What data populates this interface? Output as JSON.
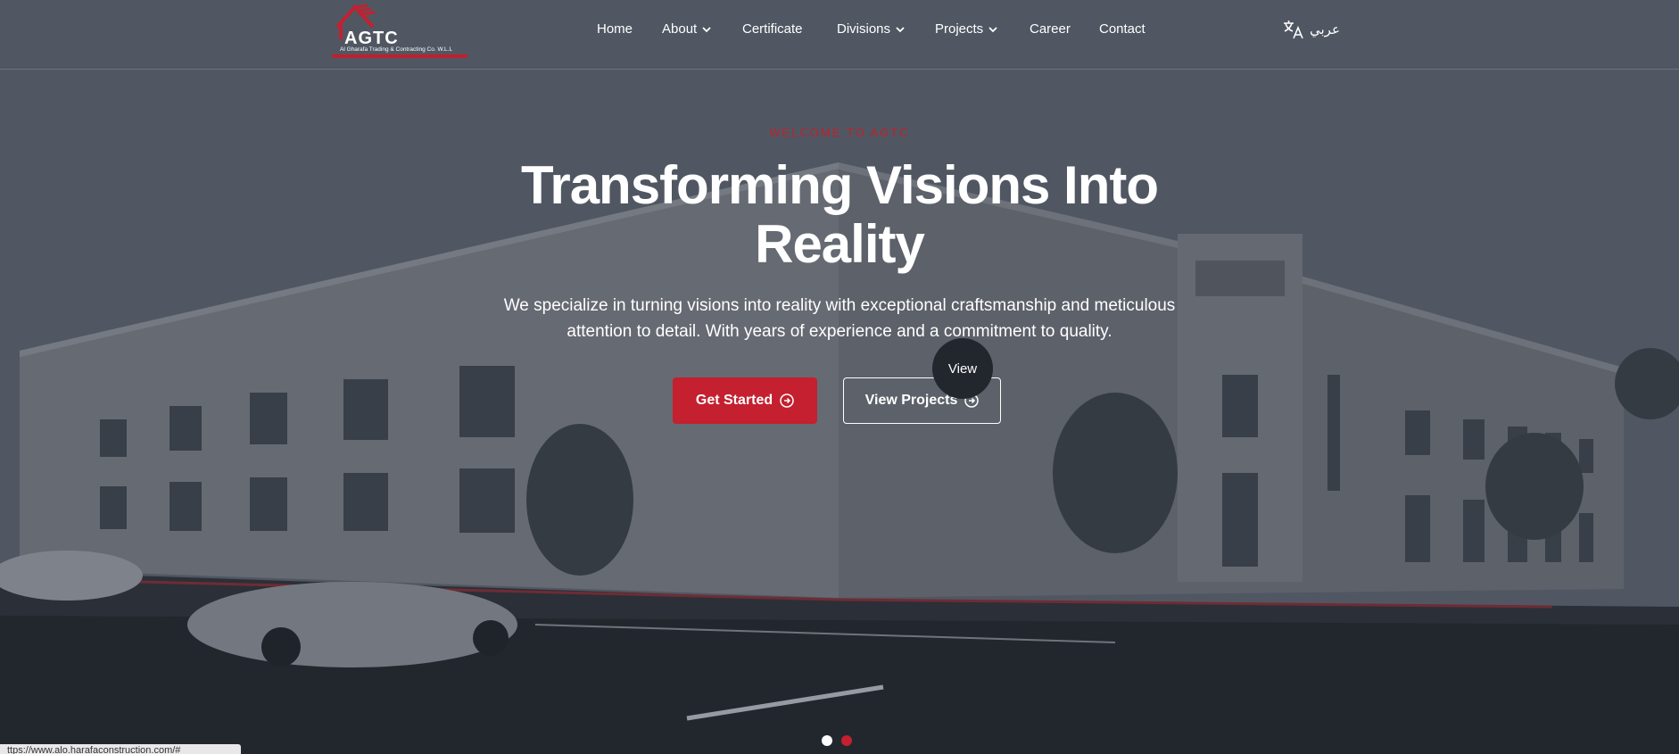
{
  "brand": {
    "name": "AGTC",
    "tagline": "Al Gharafa Trading & Contracting Co. W.L.L",
    "accent": "#c4202f"
  },
  "nav": {
    "items": [
      {
        "label": "Home",
        "has_dropdown": false
      },
      {
        "label": "About",
        "has_dropdown": true
      },
      {
        "label": "Certificate",
        "has_dropdown": false
      },
      {
        "label": "Divisions",
        "has_dropdown": true
      },
      {
        "label": "Projects",
        "has_dropdown": true
      },
      {
        "label": "Career",
        "has_dropdown": false
      },
      {
        "label": "Contact",
        "has_dropdown": false
      }
    ],
    "language_label": "عربي",
    "language_icon": "translate-icon"
  },
  "hero": {
    "eyebrow": "WELCOME TO AGTC",
    "title": "Transforming Visions Into Reality",
    "description": "We specialize in turning visions into reality with exceptional craftsmanship and meticulous attention to detail. With years of experience and a commitment to quality.",
    "primary_button": "Get Started",
    "secondary_button": "View Projects",
    "button_icon": "arrow-right-circle-icon",
    "cursor_label": "View"
  },
  "slider": {
    "dot_colors": [
      "#ffffff",
      "#c4202f"
    ]
  },
  "status_bar": {
    "url": "ttps://www.alo.harafaconstruction.com/#"
  }
}
